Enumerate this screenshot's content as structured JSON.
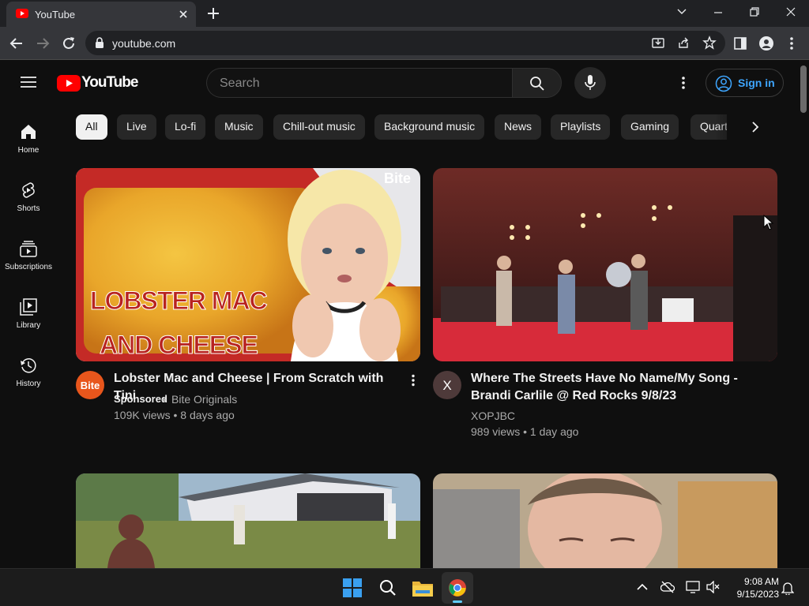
{
  "browser": {
    "tab_title": "YouTube",
    "url": "youtube.com"
  },
  "header": {
    "logo_text": "YouTube",
    "search_placeholder": "Search",
    "signin_label": "Sign in"
  },
  "sidebar": {
    "items": [
      {
        "label": "Home",
        "icon": "home-icon"
      },
      {
        "label": "Shorts",
        "icon": "shorts-icon"
      },
      {
        "label": "Subscriptions",
        "icon": "subscriptions-icon"
      },
      {
        "label": "Library",
        "icon": "library-icon"
      },
      {
        "label": "History",
        "icon": "history-icon"
      }
    ]
  },
  "chips": [
    "All",
    "Live",
    "Lo-fi",
    "Music",
    "Chill-out music",
    "Background music",
    "News",
    "Playlists",
    "Gaming",
    "Quartets"
  ],
  "videos": [
    {
      "title": "Lobster Mac and Cheese | From Scratch with Tini",
      "thumb_text_line1": "LOBSTER MAC",
      "thumb_text_line2": "AND CHEESE",
      "thumb_brand": "Bite",
      "avatar_text": "Bite",
      "sponsored": "Sponsored",
      "channel": "Bite Originals",
      "meta": "109K views • 8 days ago"
    },
    {
      "title_line1": "Where The Streets Have No Name/My Song -",
      "title_line2": "Brandi Carlile @ Red Rocks 9/8/23",
      "avatar_text": "X",
      "channel": "XOPJBC",
      "meta": "989 views • 1 day ago"
    }
  ],
  "taskbar": {
    "time": "9:08 AM",
    "date": "9/15/2023"
  },
  "colors": {
    "youtube_red": "#ff0000",
    "link_blue": "#3ea6ff",
    "bite_orange": "#e8561c"
  }
}
